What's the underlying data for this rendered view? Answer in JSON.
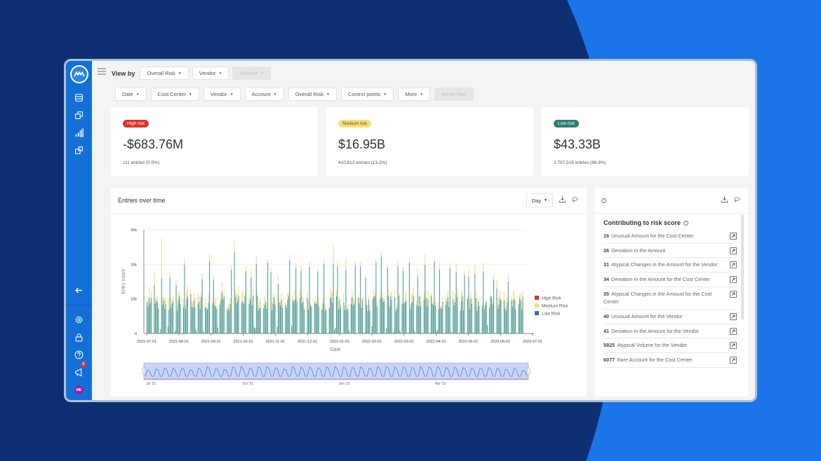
{
  "colors": {
    "bg_dark": "#0f2f74",
    "bg_bright": "#1b74e8",
    "sidebar": "#1470d8",
    "high_risk": "#d9342b",
    "medium_risk": "#f6dd7d",
    "low_risk": "#2f7d72",
    "bar_low": "#4f9d92",
    "bar_medium": "#f3dc8a",
    "brush_fill": "#c9d3fb",
    "brush_line": "#4a8fc9"
  },
  "sidebar": {
    "logo": "mindbridge-logo-icon",
    "icons": [
      "table-icon",
      "copy-icon",
      "bar-chart-icon",
      "export-icon"
    ],
    "bottom_icons": [
      "collapse-arrow-icon",
      "gear-icon",
      "lock-icon",
      "help-icon",
      "megaphone-icon"
    ],
    "notification_count": "6",
    "avatar_initials": "ME"
  },
  "viewby": {
    "label": "View by",
    "options": [
      {
        "label": "Overall Risk",
        "disabled": false
      },
      {
        "label": "Vendor",
        "disabled": false
      },
      {
        "label": "Amount",
        "disabled": true
      }
    ]
  },
  "filters": {
    "items": [
      "Date",
      "Cost Center",
      "Vendor",
      "Account",
      "Overall Risk",
      "Control points",
      "More"
    ],
    "reset_label": "Reset filter"
  },
  "kpis": [
    {
      "badge": "High risk",
      "value": "-$683.76M",
      "sub": "111 entries (0.0%)",
      "badge_color": "#d9342b",
      "badge_text_color": "#ffffff"
    },
    {
      "badge": "Medium risk",
      "value": "$16.95B",
      "sub": "410,813 entries (13.2%)",
      "badge_color": "#f6dd7d",
      "badge_text_color": "#6b5a14"
    },
    {
      "badge": "Low risk",
      "value": "$43.33B",
      "sub": "2,707,516 entries (86.8%)",
      "badge_color": "#2f7d72",
      "badge_text_color": "#ffffff"
    }
  ],
  "entries_card": {
    "title": "Entries over time",
    "granularity": "Day",
    "download_icon": "download-icon",
    "comment_icon": "comment-icon"
  },
  "risk_card": {
    "title": "Contributing to risk score",
    "items": [
      {
        "num": "16",
        "text": "Unusual Amount for the Cost Center"
      },
      {
        "num": "26",
        "text": "Deviation in the Amount"
      },
      {
        "num": "31",
        "text": "Atypical Changes in the Amount for the Vendor"
      },
      {
        "num": "34",
        "text": "Deviation in the Amount for the Cost Center"
      },
      {
        "num": "35",
        "text": "Atypical Changes in the Amount for the Cost Center"
      },
      {
        "num": "40",
        "text": "Unusual Amount for the Vendor"
      },
      {
        "num": "41",
        "text": "Deviation in the Amount for the Vendor"
      },
      {
        "num": "5825",
        "text": "Atypical Volume for the Vendor"
      },
      {
        "num": "6077",
        "text": "Rare Account for the Cost Center"
      }
    ]
  },
  "chart_data": {
    "type": "bar",
    "stacked": true,
    "title": "Entries over time",
    "xlabel": "Date",
    "ylabel": "Entry count",
    "ylim": [
      0,
      30000
    ],
    "yticks": [
      0,
      10000,
      20000,
      30000
    ],
    "ytick_labels": [
      "0",
      "10k",
      "20k",
      "30k"
    ],
    "xtick_labels": [
      "2021-07-01",
      "2021-08-01",
      "2021-09-01",
      "2021-10-01",
      "2021-11-01",
      "2021-12-01",
      "2022-01-01",
      "2022-02-01",
      "2022-03-01",
      "2022-04-01",
      "2022-05-01",
      "2022-06-01",
      "2022-07-01"
    ],
    "x_range": [
      "2021-07-01",
      "2022-07-01"
    ],
    "legend": {
      "placement": "right",
      "entries": [
        "High Risk",
        "Medium Risk",
        "Low Risk"
      ]
    },
    "grid": true,
    "series_note": "Daily entries; weekdays ~8k-24k low-risk plus ~1k-11k medium-risk, weekends near 0. High risk negligible.",
    "sample_weekly_peaks": {
      "low": [
        10400,
        14000,
        16000,
        16200,
        14000,
        20000,
        11500,
        15700,
        20800,
        15500,
        12200,
        18500,
        23500,
        18000,
        16200,
        20200,
        20500,
        17800,
        14200,
        21200,
        19000,
        18200,
        19300,
        17900,
        20100,
        20200,
        19500,
        18300,
        19800,
        19400,
        16000,
        20500,
        22200,
        19000,
        19500,
        18200,
        20500,
        16500,
        19900,
        20800,
        18500,
        18900,
        17800,
        17000,
        16500,
        17200,
        18000,
        15500,
        13000,
        15000,
        9500,
        8500
      ],
      "medium": [
        3300,
        3800,
        11500,
        1500,
        1500,
        2000,
        1500,
        1600,
        2100,
        1200,
        2800,
        1200,
        3100,
        1500,
        2200,
        2200,
        1000,
        1200,
        2500,
        1500,
        1200,
        1500,
        1500,
        800,
        1000,
        5500,
        1500,
        3500,
        1000,
        1200,
        1000,
        1200,
        1500,
        1000,
        1500,
        1200,
        1200,
        2500,
        3000,
        1500,
        2500,
        1500,
        2500,
        1200,
        2000,
        2500,
        2500,
        1500,
        2500,
        2000,
        1500,
        1000
      ]
    },
    "navigator": {
      "xtick_labels": [
        "Jul '21",
        "Oct '21",
        "Jan '22",
        "Apr '22"
      ],
      "selected_range": "full"
    }
  }
}
